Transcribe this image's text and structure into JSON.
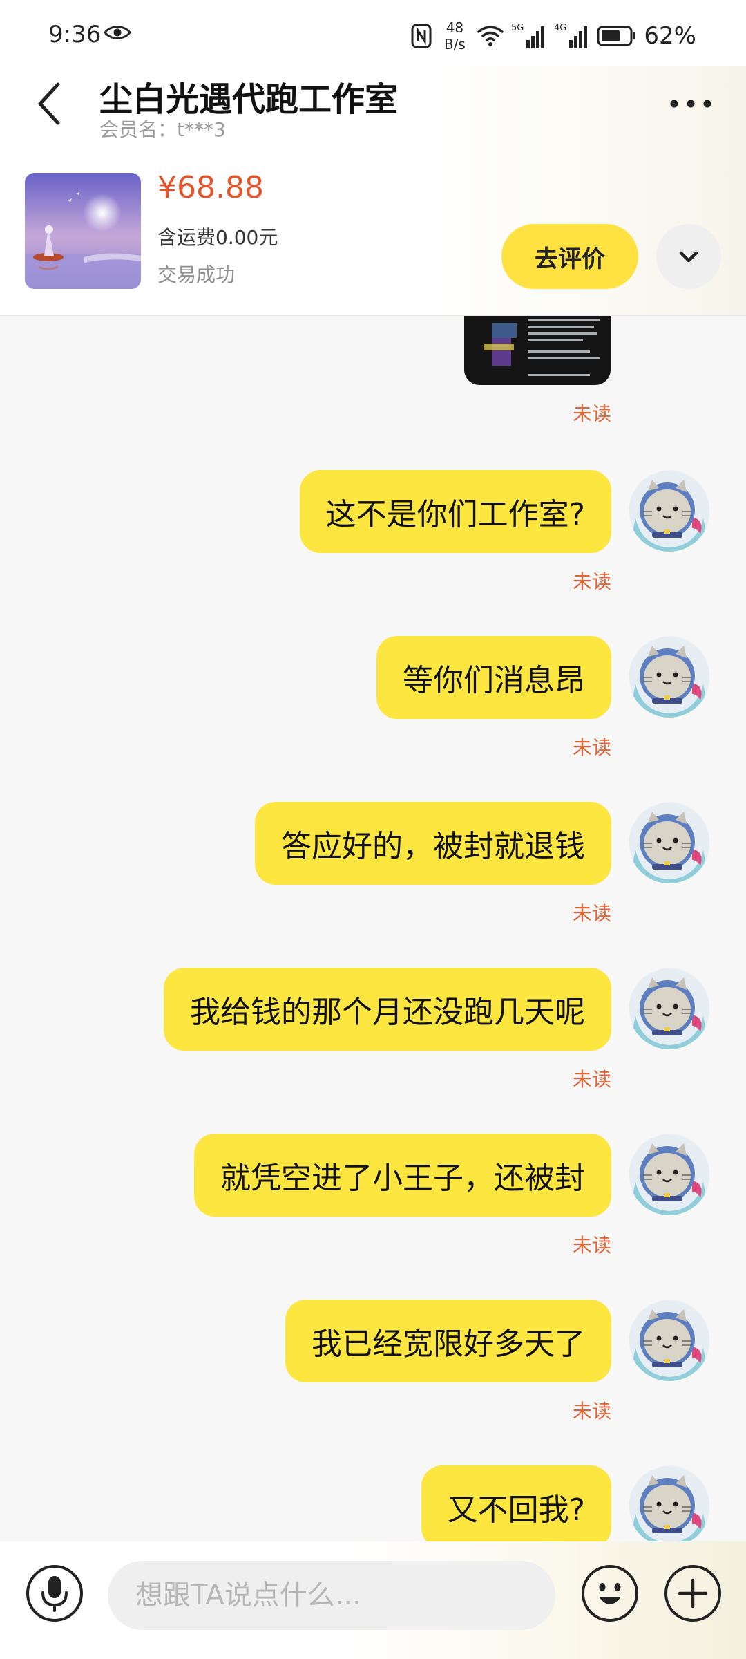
{
  "status_bar": {
    "time": "9:36",
    "net_speed_value": "48",
    "net_speed_unit": "B/s",
    "signal_1_label": "5G",
    "signal_2_label": "4G",
    "battery_percent": "62%"
  },
  "header": {
    "title": "尘白光遇代跑工作室",
    "member_label": "会员名：t***3"
  },
  "order": {
    "price": "¥68.88",
    "shipping": "含运费0.00元",
    "status": "交易成功",
    "review_button": "去评价"
  },
  "chat": {
    "image_message_status": "未读",
    "messages": [
      {
        "text": "这不是你们工作室?",
        "status": "未读"
      },
      {
        "text": "等你们消息昂",
        "status": "未读"
      },
      {
        "text": "答应好的，被封就退钱",
        "status": "未读"
      },
      {
        "text": "我给钱的那个月还没跑几天呢",
        "status": "未读"
      },
      {
        "text": "就凭空进了小王子，还被封",
        "status": "未读"
      },
      {
        "text": "我已经宽限好多天了",
        "status": "未读"
      },
      {
        "text": "又不回我?",
        "status": ""
      }
    ]
  },
  "input": {
    "placeholder": "想跟TA说点什么..."
  },
  "colors": {
    "accent_yellow": "#FDE640",
    "price_orange": "#E4532A",
    "unread_orange": "#E06434"
  },
  "icons": [
    "eye-icon",
    "nfc-icon",
    "wifi-icon",
    "signal-icon",
    "battery-icon",
    "back-arrow-icon",
    "more-dots-icon",
    "chevron-down-icon",
    "microphone-icon",
    "emoji-icon",
    "plus-icon"
  ]
}
